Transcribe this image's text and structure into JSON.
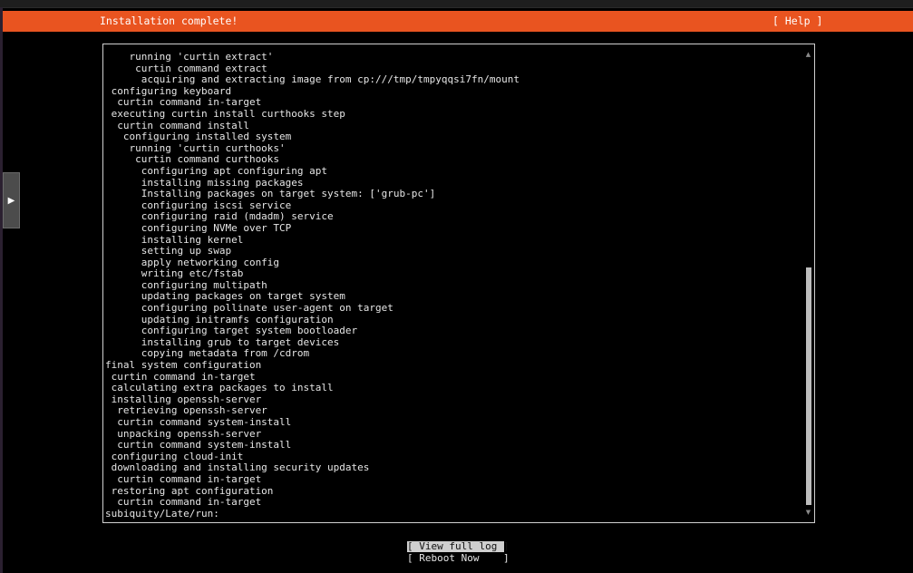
{
  "header": {
    "title": "Installation complete!",
    "help_label": "[ Help ]",
    "accent_color": "#e95420"
  },
  "side_tab": {
    "icon": "play-arrow-icon",
    "glyph": "▶"
  },
  "log": {
    "lines": [
      "    running 'curtin extract'",
      "     curtin command extract",
      "      acquiring and extracting image from cp:///tmp/tmpyqqsi7fn/mount",
      " configuring keyboard",
      "  curtin command in-target",
      " executing curtin install curthooks step",
      "  curtin command install",
      "   configuring installed system",
      "    running 'curtin curthooks'",
      "     curtin command curthooks",
      "      configuring apt configuring apt",
      "      installing missing packages",
      "      Installing packages on target system: ['grub-pc']",
      "      configuring iscsi service",
      "      configuring raid (mdadm) service",
      "      configuring NVMe over TCP",
      "      installing kernel",
      "      setting up swap",
      "      apply networking config",
      "      writing etc/fstab",
      "      configuring multipath",
      "      updating packages on target system",
      "      configuring pollinate user-agent on target",
      "      updating initramfs configuration",
      "      configuring target system bootloader",
      "      installing grub to target devices",
      "      copying metadata from /cdrom",
      "final system configuration",
      " curtin command in-target",
      " calculating extra packages to install",
      " installing openssh-server",
      "  retrieving openssh-server",
      "  curtin command system-install",
      "  unpacking openssh-server",
      "  curtin command system-install",
      " configuring cloud-init",
      " downloading and installing security updates",
      "  curtin command in-target",
      " restoring apt configuration",
      "  curtin command in-target",
      "subiquity/Late/run:"
    ],
    "scroll_up_glyph": "▲",
    "scroll_down_glyph": "▼"
  },
  "buttons": {
    "view_full_log": "[ View full log ]",
    "reboot_now": "[ Reboot Now    ]"
  }
}
